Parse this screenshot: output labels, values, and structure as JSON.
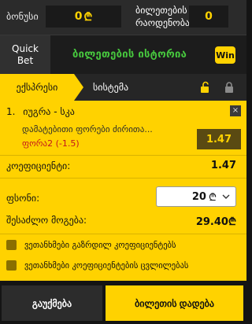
{
  "topbar": {
    "bonus_label": "ბონუსი",
    "bonus_value": "0",
    "currency_symbol": "₾",
    "tickets_label_line1": "ბილეთების",
    "tickets_label_line2": "რაოდენობა",
    "tickets_value": "0"
  },
  "history_bar": {
    "quick_bet_line1": "Quick",
    "quick_bet_line2": "Bet",
    "title": "ბილეთების ისტორია",
    "logo_text": "Win"
  },
  "tabs": {
    "express": "ექსპრესი",
    "system": "სისტემა"
  },
  "selection": {
    "number": "1.",
    "event": "იუგრა - სკა",
    "market": "დამატებითი ფორები ძირითა...",
    "pick_prefix": "ფორა",
    "pick_value": "2 (-1.5)",
    "odds": "1.47",
    "close": "×"
  },
  "summary": {
    "coef_label": "კოეფიციენტი:",
    "coef_value": "1.47",
    "stake_label": "ფსონი:",
    "stake_value": "20",
    "stake_currency": "₾",
    "win_label": "შესაძლო მოგება:",
    "win_value": "29.40₾"
  },
  "options": [
    {
      "label": "ვეთანხმები გაზრდილ კოეფიციენტებს",
      "checked": false
    },
    {
      "label": "ვეთანხმები კოეფიციენტების ცვლილებას",
      "checked": false
    }
  ],
  "actions": {
    "cancel": "გაუქმება",
    "place": "ბილეთის დადება"
  },
  "colors": {
    "accent": "#ffd200",
    "history_green": "#47c83e",
    "pick_red": "#c4161c",
    "background": "#141414"
  }
}
